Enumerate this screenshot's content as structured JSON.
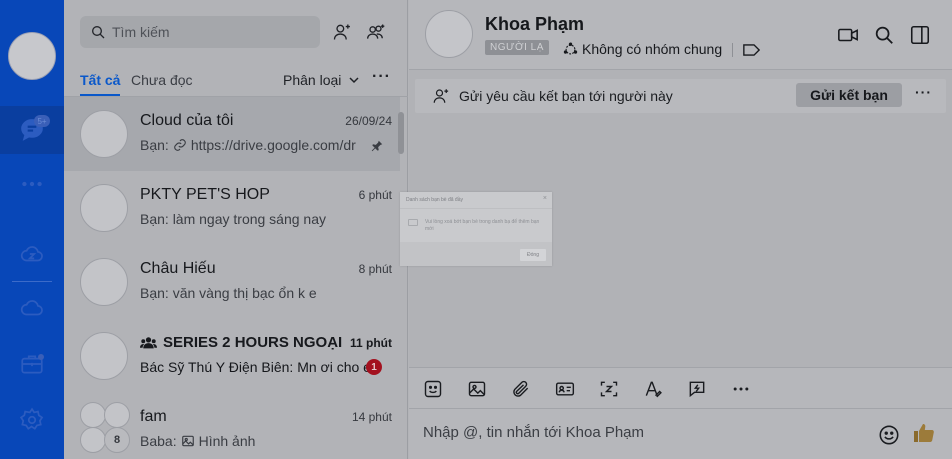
{
  "search": {
    "placeholder": "Tìm kiếm"
  },
  "tabs": {
    "all": "Tất cả",
    "unread": "Chưa đọc",
    "classify": "Phân loại",
    "more": "···"
  },
  "conversations": [
    {
      "name": "Cloud của tôi",
      "time": "26/09/24",
      "preview": "https://drive.google.com/dr",
      "sender": "Bạn:"
    },
    {
      "name": "PKTY PET'S HOP",
      "time": "6 phút",
      "preview": "Bạn: làm ngay trong sáng nay"
    },
    {
      "name": "Châu Hiếu",
      "time": "8 phút",
      "preview": "Bạn: văn vàng thị bạc ổn k e"
    },
    {
      "name": "SERIES 2 HOURS NGOẠI",
      "time": "11 phút",
      "preview": "Bác Sỹ Thú Y Điện Biên: Mn ơi cho e",
      "unread": "1"
    },
    {
      "name": "fam",
      "time": "14 phút",
      "sender": "Baba:",
      "preview": "Hình ảnh",
      "member_count": "8"
    }
  ],
  "chat": {
    "title": "Khoa Phạm",
    "stranger_badge": "NGƯỜI LẠ",
    "no_common_group": "Không có nhóm chung",
    "friend_request_text": "Gửi yêu cầu kết bạn tới người này",
    "send_friend_button": "Gửi kết bạn",
    "friend_more": "···",
    "composer_placeholder": "Nhập @, tin nhắn tới Khoa Phạm"
  },
  "dialog": {
    "title": "Danh sách bạn bè đã đầy",
    "message": "Vui lòng xoá bớt bạn bè trong danh bạ để thêm bạn mới",
    "close_button": "Đóng",
    "close_icon": "×"
  },
  "rail": {
    "unread_badge": "5+"
  },
  "colors": {
    "rail": "#0847b8",
    "accent": "#0a58ca",
    "badge": "#a3111f"
  }
}
